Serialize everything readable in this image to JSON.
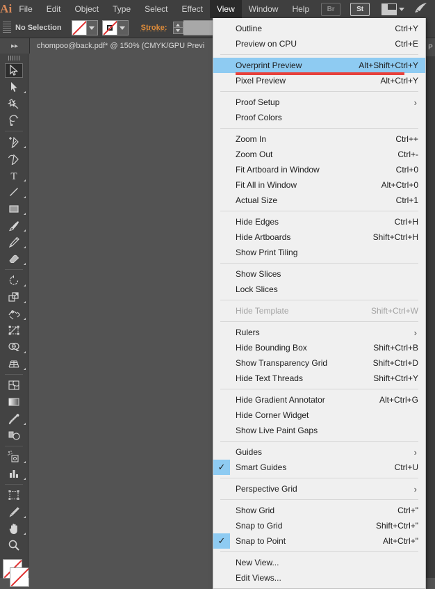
{
  "app": {
    "logo": "Ai",
    "menubar": [
      "File",
      "Edit",
      "Object",
      "Type",
      "Select",
      "Effect",
      "View",
      "Window",
      "Help"
    ],
    "active_menu": "View",
    "right_buttons": [
      {
        "name": "bridge-button",
        "label": "Br",
        "enabled": false
      },
      {
        "name": "stock-button",
        "label": "St",
        "enabled": true
      }
    ],
    "arrange_documents": "arrange-documents-icon",
    "search_icon": "rocket-search-icon"
  },
  "control_bar": {
    "selection_status": "No Selection",
    "fill_swatch": "none-fill-swatch",
    "stroke_swatch": "none-stroke-swatch",
    "stroke_label": "Stroke:",
    "stroke_weight_value": ""
  },
  "document_tab": {
    "title": "chompoo@back.pdf* @ 150% (CMYK/GPU Previ"
  },
  "right_dock": {
    "tab_label": "P"
  },
  "tools": [
    {
      "name": "selection-tool",
      "glyph": "selection",
      "selected": true,
      "flyout": false
    },
    {
      "name": "direct-selection-tool",
      "glyph": "direct-selection",
      "selected": false,
      "flyout": true
    },
    {
      "name": "magic-wand-tool",
      "glyph": "magic-wand",
      "selected": false,
      "flyout": false
    },
    {
      "name": "lasso-tool",
      "glyph": "lasso",
      "selected": false,
      "flyout": false
    },
    {
      "sep": true
    },
    {
      "name": "pen-tool",
      "glyph": "pen",
      "selected": false,
      "flyout": true
    },
    {
      "name": "curvature-tool",
      "glyph": "curvature",
      "selected": false,
      "flyout": false
    },
    {
      "name": "type-tool",
      "glyph": "type",
      "selected": false,
      "flyout": true
    },
    {
      "name": "line-segment-tool",
      "glyph": "line",
      "selected": false,
      "flyout": true
    },
    {
      "name": "rectangle-tool",
      "glyph": "rectangle",
      "selected": false,
      "flyout": true
    },
    {
      "name": "paintbrush-tool",
      "glyph": "paintbrush",
      "selected": false,
      "flyout": true
    },
    {
      "name": "pencil-tool",
      "glyph": "pencil",
      "selected": false,
      "flyout": true
    },
    {
      "name": "eraser-tool",
      "glyph": "eraser",
      "selected": false,
      "flyout": true
    },
    {
      "sep": true
    },
    {
      "name": "rotate-tool",
      "glyph": "rotate",
      "selected": false,
      "flyout": true
    },
    {
      "name": "scale-tool",
      "glyph": "scale",
      "selected": false,
      "flyout": true
    },
    {
      "name": "width-tool",
      "glyph": "width",
      "selected": false,
      "flyout": true
    },
    {
      "name": "free-transform-tool",
      "glyph": "free-transform",
      "selected": false,
      "flyout": false
    },
    {
      "name": "shape-builder-tool",
      "glyph": "shape-builder",
      "selected": false,
      "flyout": true
    },
    {
      "name": "perspective-grid-tool",
      "glyph": "perspective-grid",
      "selected": false,
      "flyout": true
    },
    {
      "sep": true
    },
    {
      "name": "mesh-tool",
      "glyph": "mesh",
      "selected": false,
      "flyout": false
    },
    {
      "name": "gradient-tool",
      "glyph": "gradient",
      "selected": false,
      "flyout": false
    },
    {
      "name": "eyedropper-tool",
      "glyph": "eyedropper",
      "selected": false,
      "flyout": true
    },
    {
      "name": "blend-tool",
      "glyph": "blend",
      "selected": false,
      "flyout": false
    },
    {
      "sep": true
    },
    {
      "name": "symbol-sprayer-tool",
      "glyph": "symbol-sprayer",
      "selected": false,
      "flyout": true
    },
    {
      "name": "column-graph-tool",
      "glyph": "column-graph",
      "selected": false,
      "flyout": true
    },
    {
      "sep": true
    },
    {
      "name": "artboard-tool",
      "glyph": "artboard",
      "selected": false,
      "flyout": false
    },
    {
      "name": "slice-tool",
      "glyph": "slice",
      "selected": false,
      "flyout": true
    },
    {
      "name": "hand-tool",
      "glyph": "hand",
      "selected": false,
      "flyout": true
    },
    {
      "name": "zoom-tool",
      "glyph": "zoom",
      "selected": false,
      "flyout": false
    }
  ],
  "view_menu": {
    "highlight_color": "#8ecbf2",
    "annotation_color": "#e8403a",
    "items": [
      {
        "label": "Outline",
        "accel": "Ctrl+Y"
      },
      {
        "label": "Preview on CPU",
        "accel": "Ctrl+E"
      },
      {
        "sep": true
      },
      {
        "label": "Overprint Preview",
        "accel": "Alt+Shift+Ctrl+Y",
        "highlighted": true,
        "annotated": true
      },
      {
        "label": "Pixel Preview",
        "accel": "Alt+Ctrl+Y"
      },
      {
        "sep": true
      },
      {
        "label": "Proof Setup",
        "submenu": true
      },
      {
        "label": "Proof Colors"
      },
      {
        "sep": true
      },
      {
        "label": "Zoom In",
        "accel": "Ctrl++"
      },
      {
        "label": "Zoom Out",
        "accel": "Ctrl+-"
      },
      {
        "label": "Fit Artboard in Window",
        "accel": "Ctrl+0"
      },
      {
        "label": "Fit All in Window",
        "accel": "Alt+Ctrl+0"
      },
      {
        "label": "Actual Size",
        "accel": "Ctrl+1"
      },
      {
        "sep": true
      },
      {
        "label": "Hide Edges",
        "accel": "Ctrl+H"
      },
      {
        "label": "Hide Artboards",
        "accel": "Shift+Ctrl+H"
      },
      {
        "label": "Show Print Tiling"
      },
      {
        "sep": true
      },
      {
        "label": "Show Slices"
      },
      {
        "label": "Lock Slices"
      },
      {
        "sep": true
      },
      {
        "label": "Hide Template",
        "accel": "Shift+Ctrl+W",
        "disabled": true
      },
      {
        "sep": true
      },
      {
        "label": "Rulers",
        "submenu": true
      },
      {
        "label": "Hide Bounding Box",
        "accel": "Shift+Ctrl+B"
      },
      {
        "label": "Show Transparency Grid",
        "accel": "Shift+Ctrl+D"
      },
      {
        "label": "Hide Text Threads",
        "accel": "Shift+Ctrl+Y"
      },
      {
        "sep": true
      },
      {
        "label": "Hide Gradient Annotator",
        "accel": "Alt+Ctrl+G"
      },
      {
        "label": "Hide Corner Widget"
      },
      {
        "label": "Show Live Paint Gaps"
      },
      {
        "sep": true
      },
      {
        "label": "Guides",
        "submenu": true
      },
      {
        "label": "Smart Guides",
        "accel": "Ctrl+U",
        "checked": true
      },
      {
        "sep": true
      },
      {
        "label": "Perspective Grid",
        "submenu": true
      },
      {
        "sep": true
      },
      {
        "label": "Show Grid",
        "accel": "Ctrl+\""
      },
      {
        "label": "Snap to Grid",
        "accel": "Shift+Ctrl+\""
      },
      {
        "label": "Snap to Point",
        "accel": "Alt+Ctrl+\"",
        "checked": true
      },
      {
        "sep": true
      },
      {
        "label": "New View..."
      },
      {
        "label": "Edit Views..."
      }
    ]
  }
}
